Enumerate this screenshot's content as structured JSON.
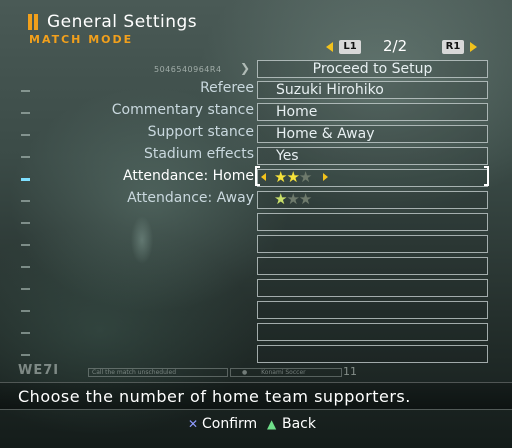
{
  "header": {
    "title": "General Settings",
    "subtitle": "MATCH MODE"
  },
  "pager": {
    "left_button": "L1",
    "page": "2/2",
    "right_button": "R1"
  },
  "code_line": "5046540964R4",
  "settings": [
    {
      "label": "",
      "value": "Proceed to Setup",
      "type": "button"
    },
    {
      "label": "Referee",
      "value": "Suzuki Hirohiko",
      "type": "option"
    },
    {
      "label": "Commentary stance",
      "value": "Home",
      "type": "option"
    },
    {
      "label": "Support stance",
      "value": "Home & Away",
      "type": "option"
    },
    {
      "label": "Stadium effects",
      "value": "Yes",
      "type": "option"
    },
    {
      "label": "Attendance: Home",
      "rating": 2,
      "max": 3,
      "type": "stars",
      "selected": true
    },
    {
      "label": "Attendance: Away",
      "rating": 1,
      "max": 3,
      "type": "stars"
    }
  ],
  "hud": {
    "logo": "WE7I",
    "segment_text": "Call the match unscheduled",
    "segment2_text": "Konami Soccer",
    "number": "11"
  },
  "help_text": "Choose the number of home team supporters.",
  "controls": {
    "confirm_label": "Confirm",
    "back_label": "Back"
  },
  "colors": {
    "accent": "#f2a01c",
    "arrow": "#f2c21c",
    "star_on": "#f6e23a",
    "cross": "#8f9bff",
    "triangle": "#6fe08a"
  }
}
